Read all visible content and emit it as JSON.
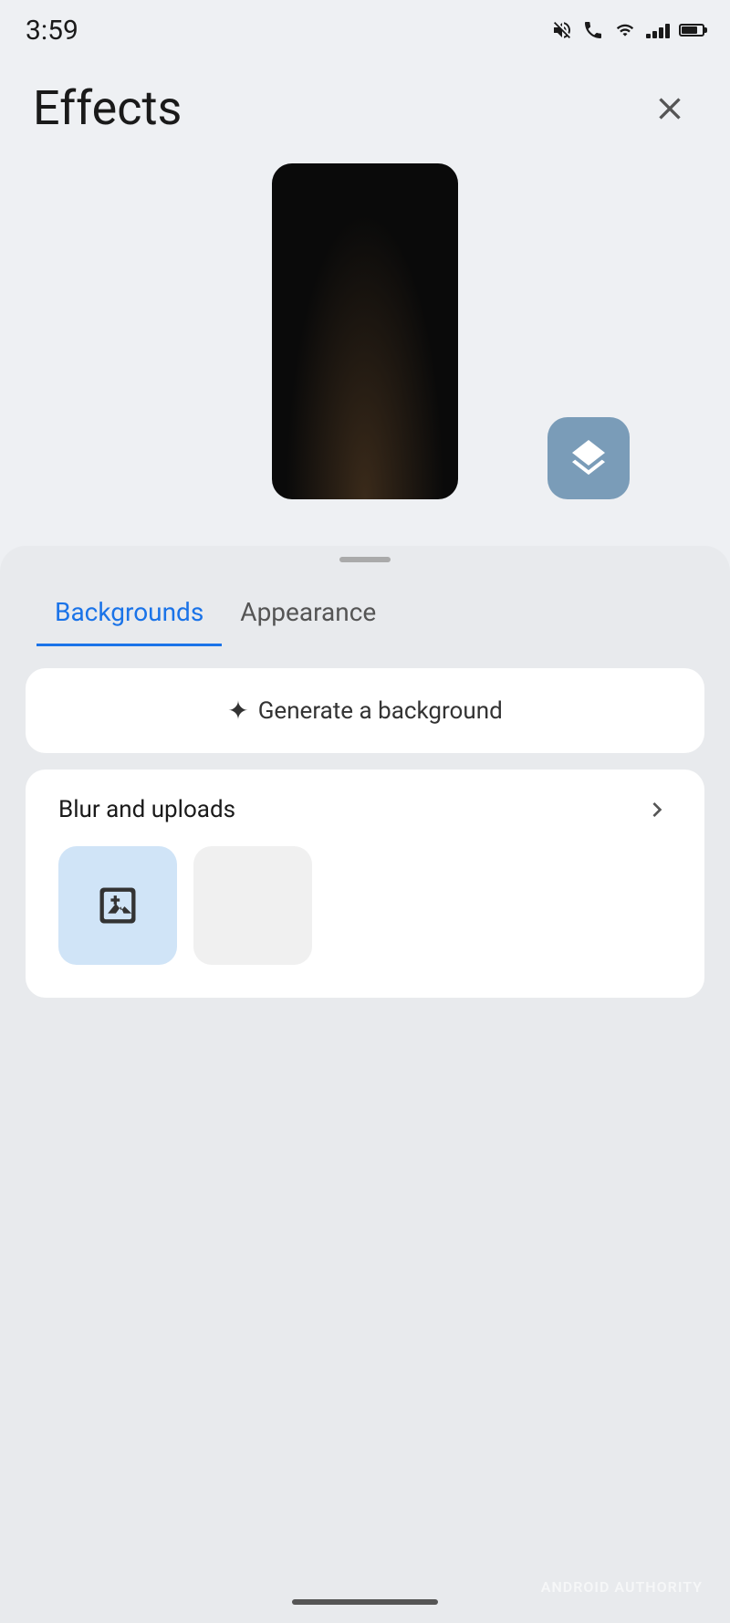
{
  "statusBar": {
    "time": "3:59",
    "icons": [
      "mute",
      "phone",
      "wifi",
      "signal",
      "battery"
    ]
  },
  "header": {
    "title": "Effects",
    "closeLabel": "×"
  },
  "tabs": [
    {
      "id": "backgrounds",
      "label": "Backgrounds",
      "active": true
    },
    {
      "id": "appearance",
      "label": "Appearance",
      "active": false
    }
  ],
  "generateCard": {
    "text": "Generate a background",
    "sparkle": "✦"
  },
  "blurCard": {
    "title": "Blur and uploads",
    "chevron": "›"
  },
  "bottomNavBar": {},
  "watermark": "ANDROID AUTHORITY",
  "colors": {
    "accent": "#1a73e8",
    "layersBtn": "#7a9cb8"
  }
}
